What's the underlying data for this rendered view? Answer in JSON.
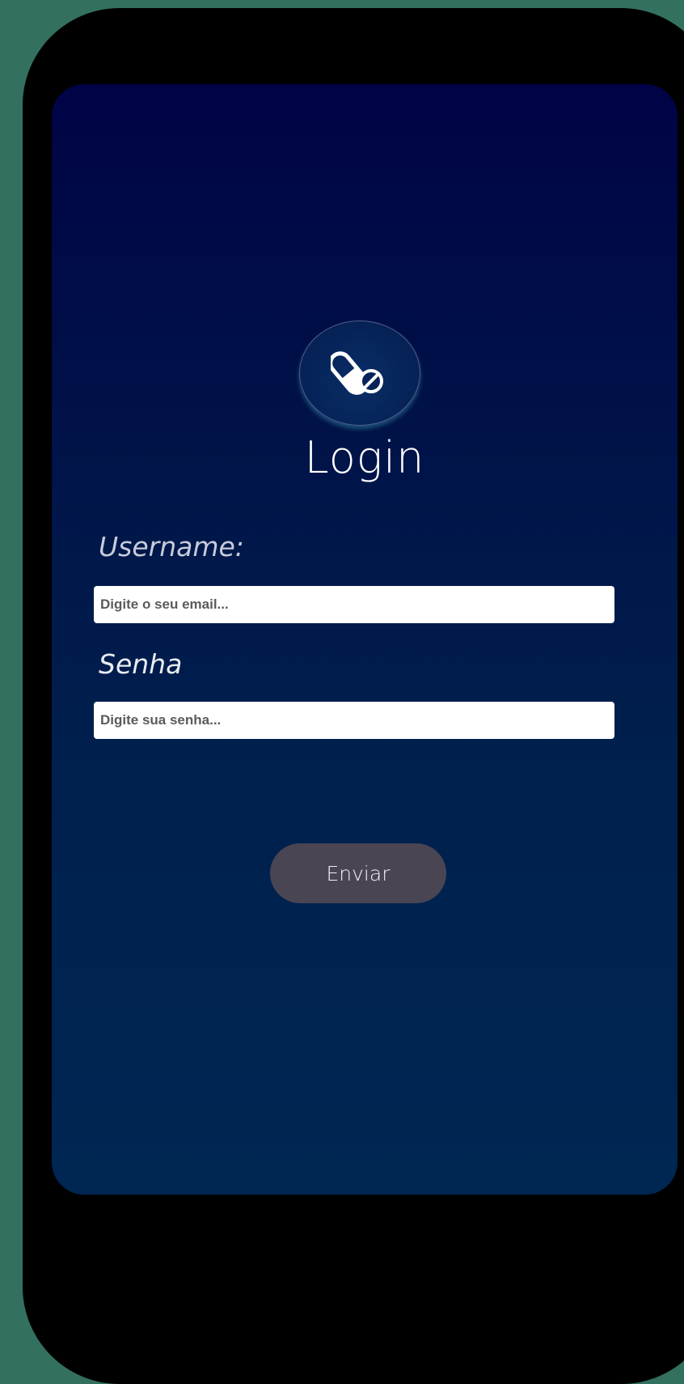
{
  "app": {
    "logo_icon": "pill-icon",
    "title": "Login"
  },
  "form": {
    "username_label": "Username:",
    "email_placeholder": "Digite o seu email...",
    "email_value": "",
    "password_label": "Senha",
    "password_placeholder": "Digite sua senha...",
    "password_value": "",
    "submit_label": "Enviar"
  },
  "colors": {
    "background": "#33705f",
    "device_frame": "#000000",
    "screen_top": "#000346",
    "screen_bottom": "#002652",
    "button": "#4a4553",
    "text": "#ffffff"
  }
}
